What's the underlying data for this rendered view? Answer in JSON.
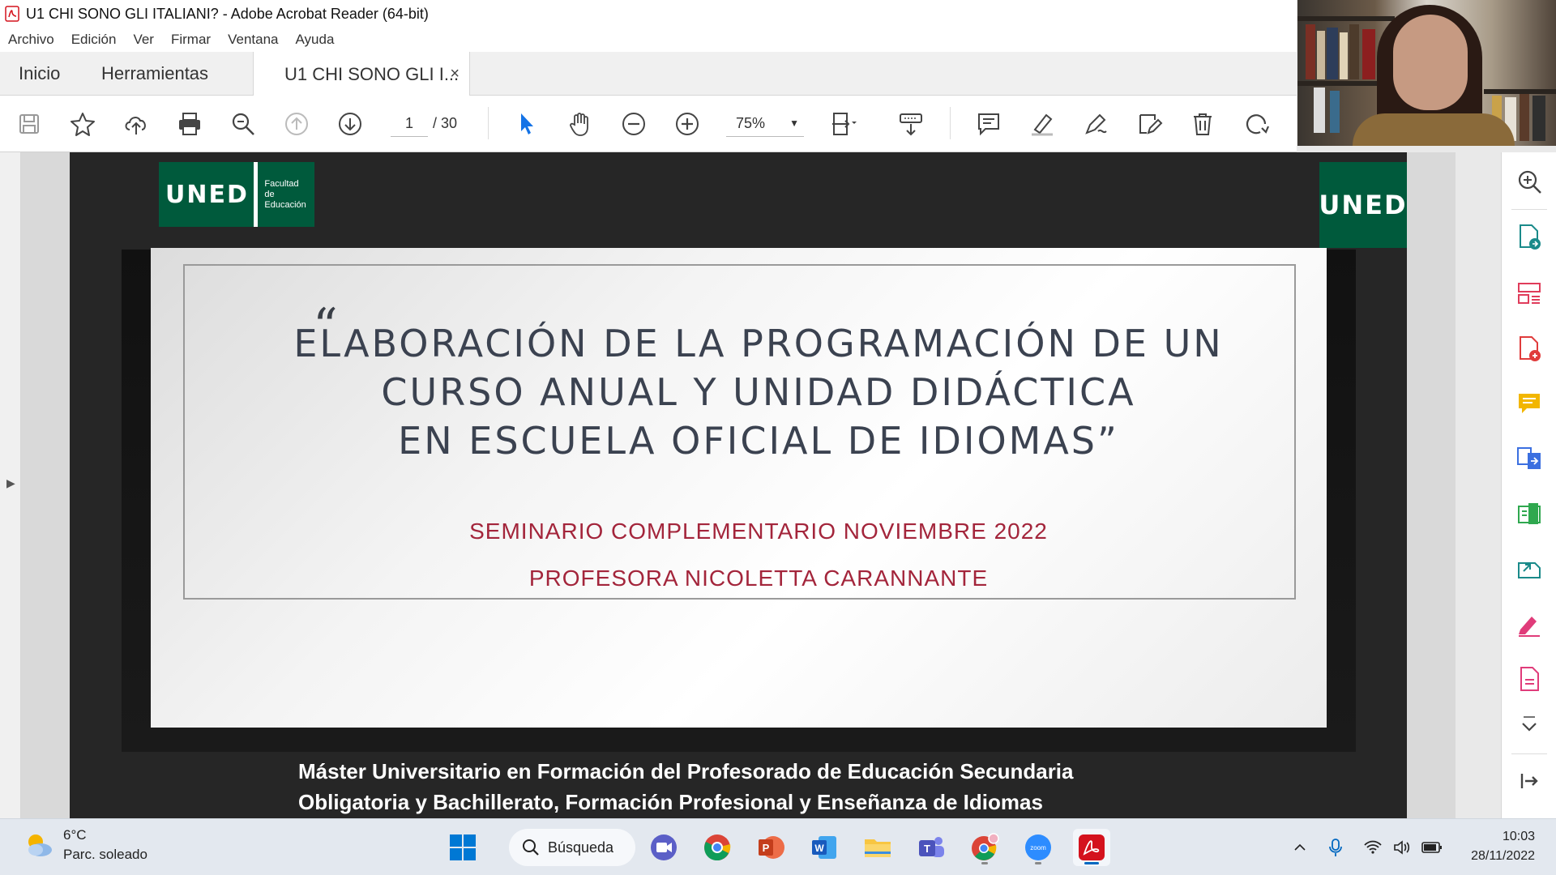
{
  "window": {
    "title": "U1 CHI SONO GLI ITALIANI? - Adobe Acrobat Reader (64-bit)"
  },
  "menu": [
    "Archivo",
    "Edición",
    "Ver",
    "Firmar",
    "Ventana",
    "Ayuda"
  ],
  "tabs": {
    "home": "Inicio",
    "tools": "Herramientas",
    "document": "U1 CHI SONO GLI I...",
    "close": "×"
  },
  "toolbar": {
    "current_page": "1",
    "page_separator": "/",
    "total_pages": "30",
    "zoom": "75%"
  },
  "slide": {
    "logo_left_text": "UNED",
    "logo_left_faculty_line1": "Facultad",
    "logo_left_faculty_line2": "de Educación",
    "logo_right_text": "UNED",
    "quote_open": "“",
    "title_line1": "ELABORACIÓN DE LA PROGRAMACIÓN DE UN",
    "title_line2": "CURSO ANUAL Y UNIDAD DIDÁCTICA",
    "title_line3": "EN ESCUELA OFICIAL DE IDIOMAS”",
    "subtitle1": "SEMINARIO COMPLEMENTARIO NOVIEMBRE 2022",
    "subtitle2": "PROFESORA NICOLETTA CARANNANTE",
    "footer_line1": "Máster Universitario en Formación del Profesorado de Educación Secundaria",
    "footer_line2": "Obligatoria y Bachillerato, Formación Profesional y Enseñanza de Idiomas"
  },
  "taskbar": {
    "weather_temp": "6°C",
    "weather_desc": "Parc. soleado",
    "search_label": "Búsqueda",
    "time": "10:03",
    "date": "28/11/2022"
  },
  "colors": {
    "uned_green": "#005a3c",
    "title_text": "#3b4250",
    "subtitle_red": "#a3253b",
    "acrobat_red": "#d4121d"
  }
}
